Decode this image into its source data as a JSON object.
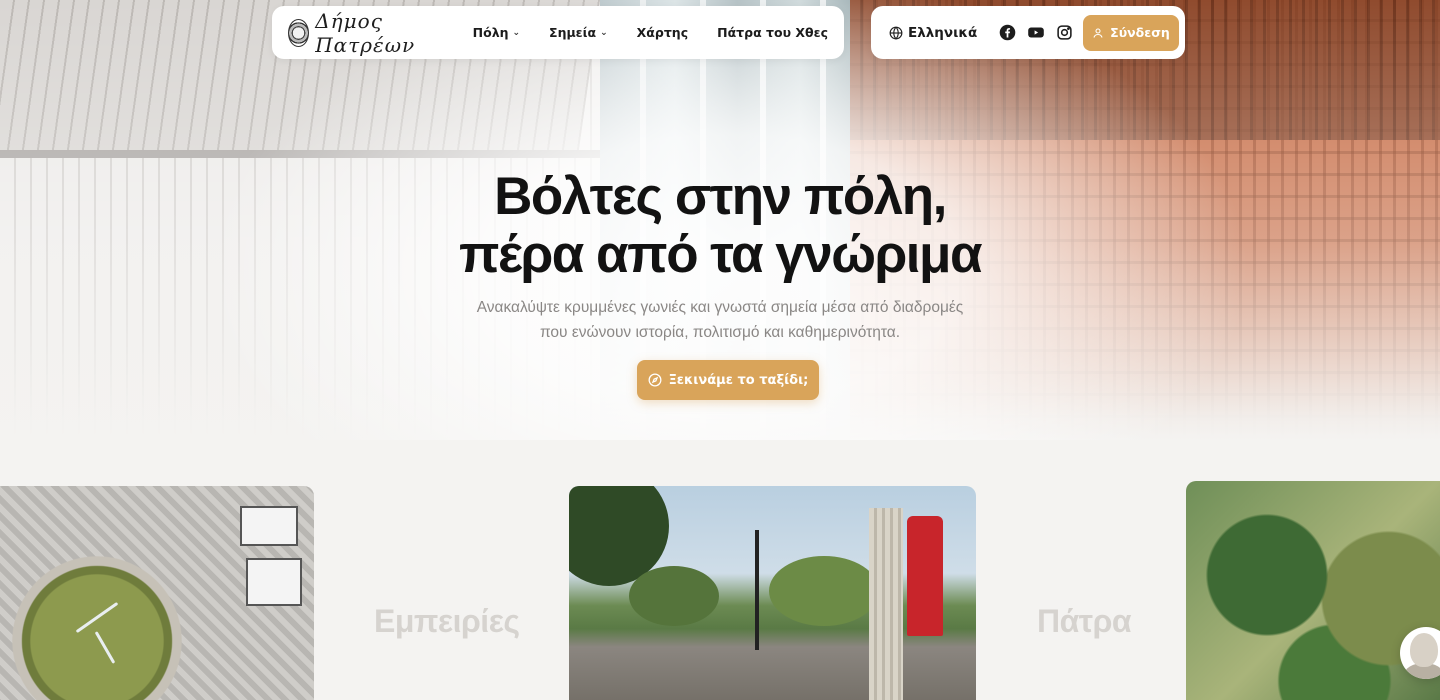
{
  "header": {
    "logo_text": "Δήμος Πατρέων",
    "menu": [
      {
        "label": "Πόλη",
        "has_dropdown": true
      },
      {
        "label": "Σημεία",
        "has_dropdown": true
      },
      {
        "label": "Χάρτης",
        "has_dropdown": false
      },
      {
        "label": "Πάτρα του Χθες",
        "has_dropdown": false
      }
    ],
    "language_label": "Ελληνικά",
    "social_icons": [
      "facebook-icon",
      "youtube-icon",
      "instagram-icon"
    ],
    "login_label": "Σύνδεση"
  },
  "hero": {
    "title_line1": "Βόλτες στην πόλη,",
    "title_line2": "πέρα από τα γνώριμα",
    "subtitle_line1": "Ανακαλύψτε κρυμμένες γωνιές και γνωστά σημεία μέσα από διαδρομές",
    "subtitle_line2": "που ενώνουν ιστορία, πολιτισμό και καθημερινότητα.",
    "cta_label": "Ξεκινάμε το ταξίδι;"
  },
  "cards": {
    "label_1": "Εμπειρίες",
    "label_2": "Πάτρα"
  },
  "colors": {
    "accent": "#d9a45a",
    "text": "#121212",
    "muted": "#8a8785"
  }
}
